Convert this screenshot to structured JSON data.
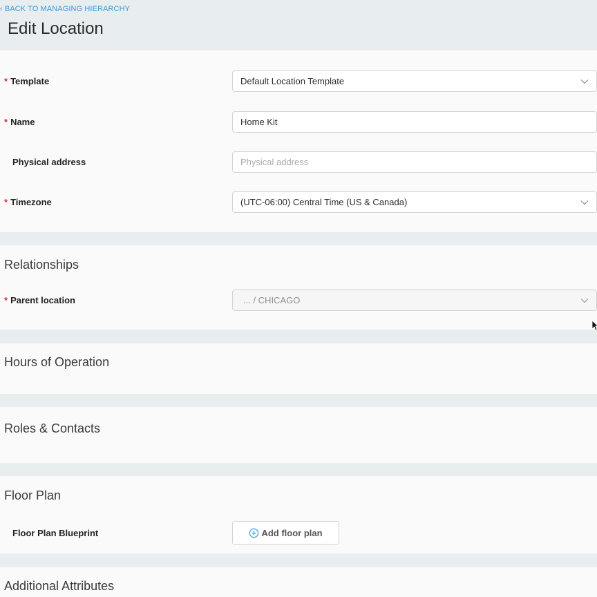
{
  "header": {
    "back_link": "BACK TO MANAGING HIERARCHY",
    "title": "Edit Location"
  },
  "form": {
    "required_marker": "*",
    "template": {
      "label": "Template",
      "value": "Default Location Template"
    },
    "name": {
      "label": "Name",
      "value": "Home Kit"
    },
    "physical_address": {
      "label": "Physical address",
      "placeholder": "Physical address"
    },
    "timezone": {
      "label": "Timezone",
      "value": "(UTC-06:00) Central Time (US & Canada)"
    }
  },
  "relationships": {
    "title": "Relationships",
    "parent_location": {
      "label": "Parent location",
      "value": "... / CHICAGO"
    }
  },
  "hours": {
    "title": "Hours of Operation"
  },
  "roles": {
    "title": "Roles & Contacts"
  },
  "floor_plan": {
    "title": "Floor Plan",
    "blueprint_label": "Floor Plan Blueprint",
    "add_button": "Add floor plan"
  },
  "additional": {
    "title": "Additional Attributes"
  },
  "colors": {
    "link": "#3a9bd5",
    "required": "#d0343a",
    "background": "#e8edf0",
    "panel": "#fafafa"
  },
  "icons": [
    "chevron-left-icon",
    "chevron-down-icon",
    "plus-circle-icon",
    "mouse-cursor-icon"
  ]
}
